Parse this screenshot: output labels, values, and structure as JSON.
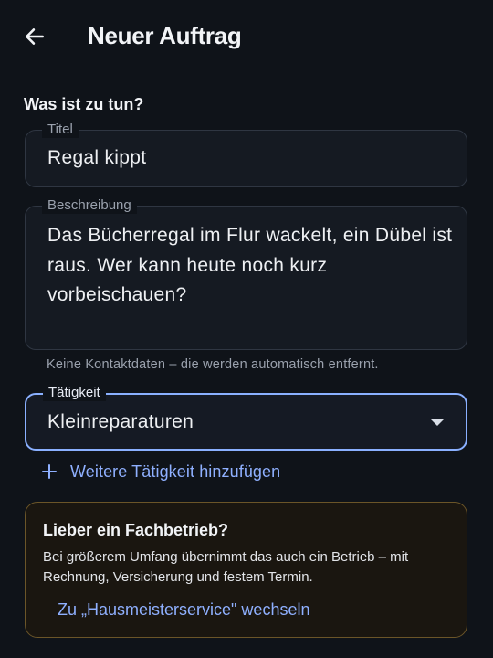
{
  "header": {
    "back_icon": "arrow-left-icon",
    "title": "Neuer Auftrag"
  },
  "section": {
    "heading": "Was ist zu tun?"
  },
  "fields": {
    "title": {
      "label": "Titel",
      "value": "Regal kippt"
    },
    "description": {
      "label": "Beschreibung",
      "value": "Das Bücherregal im Flur wackelt, ein Dübel ist raus. Wer kann heute noch kurz vorbeischauen?",
      "hint": "Keine Kontaktdaten – die werden automatisch entfernt."
    },
    "activity": {
      "label": "Tätigkeit",
      "value": "Kleinreparaturen",
      "icon": "dropdown-arrow-icon"
    }
  },
  "add_activity": {
    "icon": "plus-icon",
    "label": "Weitere Tätigkeit hinzufügen"
  },
  "info_card": {
    "title": "Lieber ein Fachbetrieb?",
    "text": "Bei größerem Umfang übernimmt das auch ein Betrieb – mit Rechnung, Versicherung und festem Termin.",
    "link": "Zu „Hausmeisterservice\" wechseln"
  },
  "colors": {
    "background": "#0f1319",
    "accent": "#8fb0ff",
    "focused_border": "#8ab0ff",
    "card_border": "#6b5528"
  }
}
